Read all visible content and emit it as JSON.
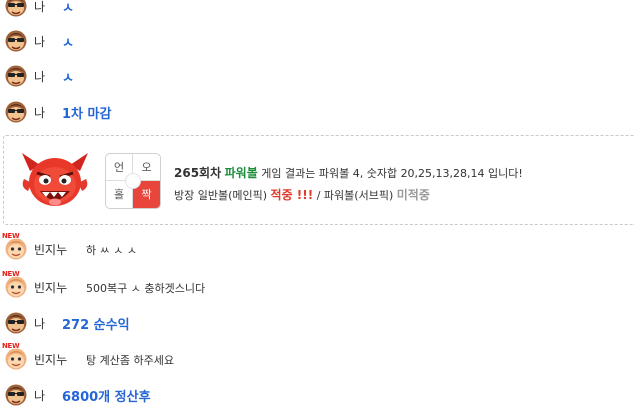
{
  "chat": {
    "rows": [
      {
        "nick": "나",
        "msg": "ㅅ"
      },
      {
        "nick": "나",
        "msg": "ㅅ"
      },
      {
        "nick": "나",
        "msg": "ㅅ"
      },
      {
        "nick": "나",
        "msg": "1차 마감"
      },
      {
        "nick": "빈지누",
        "msg": "하 ㅆ ㅅ ㅅ",
        "badge": "NEW"
      },
      {
        "nick": "빈지누",
        "msg": "500복구 ㅅ 충하겟스니다",
        "badge": "NEW"
      },
      {
        "nick": "나",
        "msg": "272 순수익"
      },
      {
        "nick": "빈지누",
        "msg": "탕 계산좀 하주세요",
        "badge": "NEW"
      },
      {
        "nick": "나",
        "msg": "6800개 정산후"
      }
    ],
    "colors": {
      "accent_blue": "#2466d4",
      "green": "#1d8f3c",
      "red": "#e03a2c",
      "gray": "#999999"
    }
  },
  "result_card": {
    "round": "265회차",
    "game": "파워볼",
    "sentence1": "게임 결과는 파워볼 4, 숫자합 20,25,13,28,14 입니다!",
    "sentence2_a": "방장 일반볼(메인픽)",
    "hit": "적중 !!!",
    "sentence2_b": "/ 파워볼(서브픽)",
    "miss": "미적중",
    "ladder": {
      "top_left": "언",
      "top_right": "오",
      "bottom_left": "홀",
      "bottom_right": "짝",
      "selected": "짝"
    },
    "icon": "red-devil-icon"
  }
}
